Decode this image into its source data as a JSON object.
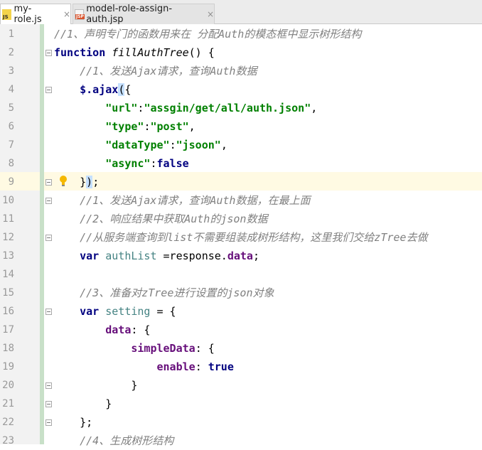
{
  "tabs": [
    {
      "label": "my-role.js",
      "icon": "js-file-icon",
      "active": true
    },
    {
      "label": "model-role-assign-auth.jsp",
      "icon": "jsp-file-icon",
      "active": false
    }
  ],
  "tab_close_glyph": "×",
  "line_numbers": [
    "1",
    "2",
    "3",
    "4",
    "5",
    "6",
    "7",
    "8",
    "9",
    "10",
    "11",
    "12",
    "13",
    "14",
    "15",
    "16",
    "17",
    "18",
    "19",
    "20",
    "21",
    "22",
    "23"
  ],
  "lines": {
    "l1": "//1、声明专门的函数用来在 分配Auth的模态框中显示树形结构",
    "l2_kw": "function",
    "l2_fn": "fillAuthTree",
    "l2_rest": "() {",
    "l3": "//1、发送Ajax请求，查询Auth数据",
    "l4_obj": "$.ajax",
    "l4_paren": "(",
    "l4_brace": "{",
    "l5_key": "\"url\"",
    "l5_colon": ":",
    "l5_val": "\"assgin/get/all/auth.json\"",
    "l5_end": ",",
    "l6_key": "\"type\"",
    "l6_colon": ":",
    "l6_val": "\"post\"",
    "l6_end": ",",
    "l7_key": "\"dataType\"",
    "l7_colon": ":",
    "l7_val": "\"jsoon\"",
    "l7_end": ",",
    "l8_key": "\"async\"",
    "l8_colon": ":",
    "l8_val": "false",
    "l9_brace": "}",
    "l9_paren": ")",
    "l9_end": ";",
    "l10": "//1、发送Ajax请求，查询Auth数据，在最上面",
    "l11": "//2、响应结果中获取Auth的json数据",
    "l12": "//从服务端查询到list不需要组装成树形结构，这里我们交给zTree去做",
    "l13_kw": "var",
    "l13_var": "authList",
    "l13_mid": " =response.",
    "l13_prop": "data",
    "l13_end": ";",
    "l15": "//3、准备对zTree进行设置的json对象",
    "l16_kw": "var",
    "l16_var": "setting",
    "l16_rest": " = {",
    "l17_prop": "data",
    "l17_rest": ": {",
    "l18_prop": "simpleData",
    "l18_rest": ": {",
    "l19_prop": "enable",
    "l19_colon": ": ",
    "l19_val": "true",
    "l20": "}",
    "l21": "}",
    "l22": "};",
    "l23": "//4、生成树形结构"
  }
}
